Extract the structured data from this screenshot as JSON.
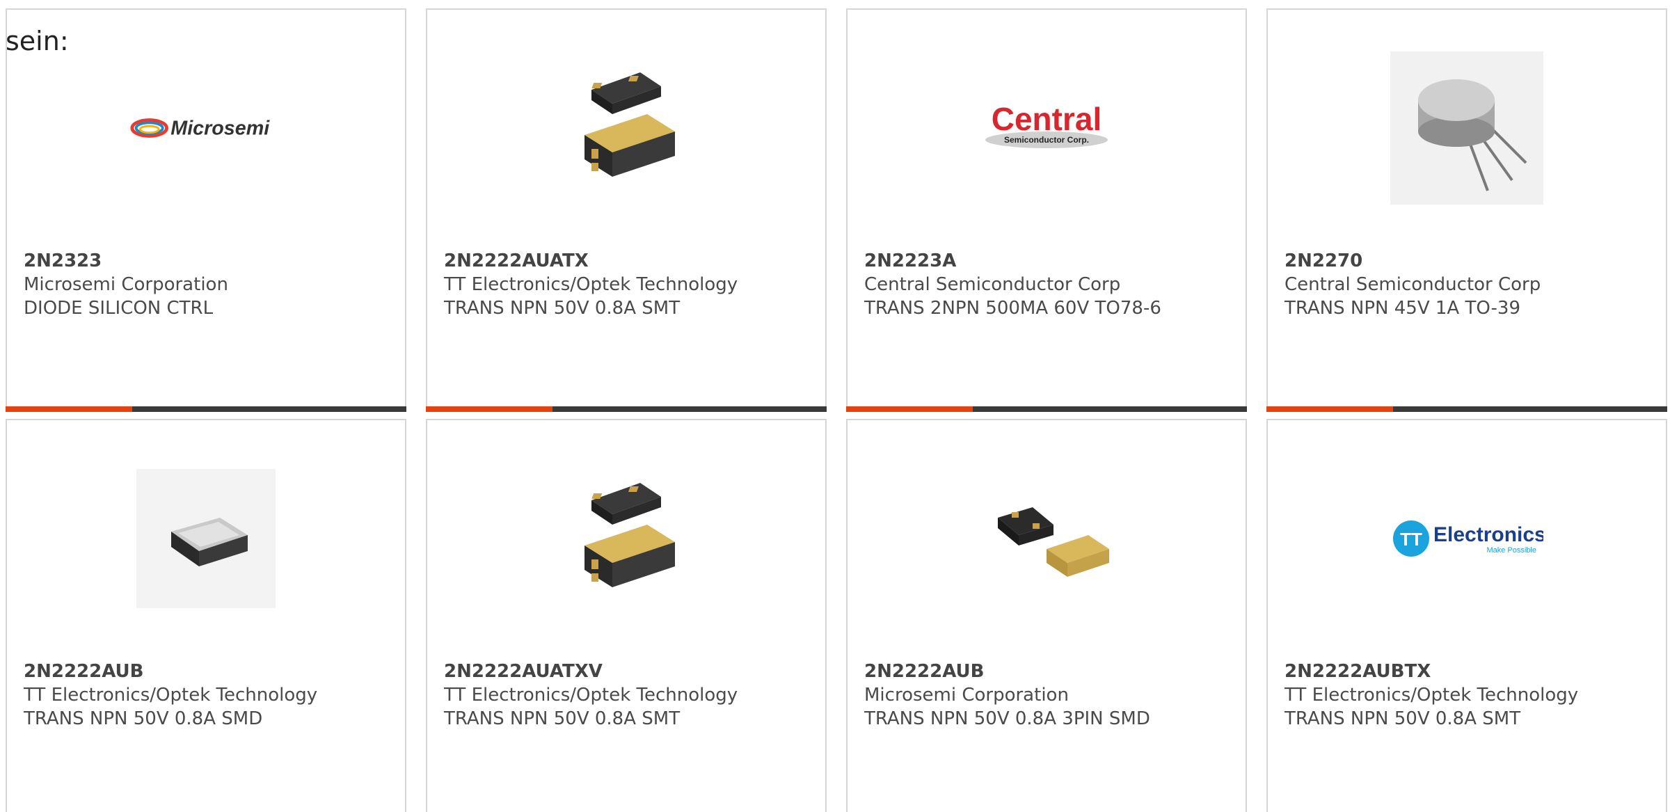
{
  "intro_text": "sein:",
  "colors": {
    "accent": "#e8420c",
    "bar": "#3a3a3a",
    "border": "#d6d6d6",
    "text": "#4a4a4a"
  },
  "cards": [
    {
      "part": "2N2323",
      "manufacturer": "Microsemi Corporation",
      "description": "DIODE SILICON CTRL",
      "image": "microsemi-logo",
      "logo_text": "Microsemi"
    },
    {
      "part": "2N2222AUATX",
      "manufacturer": "TT Electronics/Optek Technology",
      "description": "TRANS NPN 50V 0.8A SMT",
      "image": "smt-package-image"
    },
    {
      "part": "2N2223A",
      "manufacturer": "Central Semiconductor Corp",
      "description": "TRANS 2NPN 500MA 60V TO78-6",
      "image": "central-logo",
      "logo_text": "Central",
      "logo_subtext": "Semiconductor Corp."
    },
    {
      "part": "2N2270",
      "manufacturer": "Central Semiconductor Corp",
      "description": "TRANS NPN 45V 1A TO-39",
      "image": "to39-transistor-image"
    },
    {
      "part": "2N2222AUB",
      "manufacturer": "TT Electronics/Optek Technology",
      "description": "TRANS NPN 50V 0.8A SMD",
      "image": "smd-package-image"
    },
    {
      "part": "2N2222AUATXV",
      "manufacturer": "TT Electronics/Optek Technology",
      "description": "TRANS NPN 50V 0.8A SMT",
      "image": "smt-package-image"
    },
    {
      "part": "2N2222AUB",
      "manufacturer": "Microsemi Corporation",
      "description": "TRANS NPN 50V 0.8A 3PIN SMD",
      "image": "3pin-smd-image"
    },
    {
      "part": "2N2222AUBTX",
      "manufacturer": "TT Electronics/Optek Technology",
      "description": "TRANS NPN 50V 0.8A SMT",
      "image": "tt-electronics-logo",
      "logo_text": "Electronics",
      "logo_subtext": "Make Possible"
    }
  ]
}
